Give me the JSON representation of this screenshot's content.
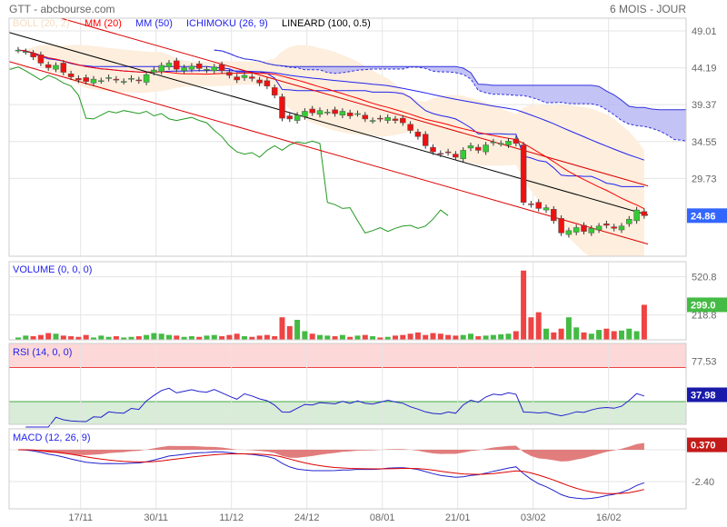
{
  "header": {
    "title": "GTT - abcbourse.com",
    "period": "6 MOIS - JOUR"
  },
  "legend": [
    {
      "label": "BOLL (20, 2)",
      "color": "#f5dcc0"
    },
    {
      "label": "MM (20)",
      "color": "#ff0000"
    },
    {
      "label": "MM (50)",
      "color": "#2222ee"
    },
    {
      "label": "ICHIMOKU (26, 9)",
      "color": "#2222ee"
    },
    {
      "label": "LINEARD (100, 0.5)",
      "color": "#000000"
    }
  ],
  "panels": {
    "volume": "VOLUME (0, 0, 0)",
    "rsi": "RSI (14, 0, 0)",
    "macd": "MACD (12, 26, 9)"
  },
  "chart_data": {
    "type": "candlestick",
    "price_ticks": [
      "49.01",
      "44.19",
      "39.37",
      "34.55",
      "29.73"
    ],
    "price_tick_values": [
      49.01,
      44.19,
      39.37,
      34.55,
      29.73
    ],
    "last_price": {
      "label": "24.86",
      "color": "#3366ff"
    },
    "volume_ticks": [
      "520.8",
      "218.8"
    ],
    "volume_tick_values": [
      520.8,
      218.8
    ],
    "last_volume": {
      "label": "299.0",
      "color": "#44bb44"
    },
    "rsi_ticks": [
      "77.53"
    ],
    "last_rsi": {
      "label": "37.98",
      "color": "#1a1aaa"
    },
    "macd_ticks": [
      "-2.40"
    ],
    "last_macd": {
      "label": "0.370",
      "color": "#c41a1a"
    },
    "x_labels": [
      "17/11",
      "30/11",
      "11/12",
      "24/12",
      "08/01",
      "21/01",
      "03/02",
      "16/02"
    ],
    "x_label_index": [
      9,
      19,
      29,
      39,
      49,
      59,
      69,
      79
    ],
    "closes": [
      46.5,
      46.3,
      45.6,
      44.8,
      44.2,
      44.5,
      43.6,
      43.0,
      42.6,
      42.4,
      42.7,
      42.5,
      42.9,
      42.6,
      42.4,
      42.8,
      42.5,
      43.3,
      43.9,
      44.5,
      44.8,
      44.0,
      44.2,
      44.4,
      44.1,
      44.0,
      44.3,
      43.8,
      43.2,
      42.6,
      43.2,
      42.8,
      42.2,
      41.8,
      40.6,
      37.6,
      37.5,
      38.0,
      38.5,
      38.3,
      38.6,
      38.4,
      38.2,
      38.5,
      37.9,
      38.2,
      37.5,
      37.3,
      37.5,
      37.7,
      37.3,
      37.0,
      36.0,
      35.2,
      34.0,
      33.2,
      32.9,
      33.1,
      32.5,
      33.4,
      34.0,
      33.4,
      34.1,
      34.5,
      34.3,
      34.6,
      34.3,
      26.6,
      26.3,
      25.8,
      25.9,
      24.2,
      22.6,
      22.9,
      23.3,
      22.8,
      23.2,
      23.5,
      23.6,
      23.2,
      23.5,
      24.4,
      25.6,
      24.86
    ],
    "volumes": [
      40,
      55,
      50,
      60,
      75,
      70,
      55,
      50,
      45,
      60,
      40,
      55,
      45,
      50,
      40,
      45,
      50,
      60,
      75,
      70,
      60,
      55,
      45,
      50,
      45,
      55,
      60,
      50,
      60,
      70,
      50,
      45,
      55,
      60,
      50,
      200,
      130,
      180,
      90,
      70,
      60,
      55,
      50,
      60,
      45,
      55,
      60,
      50,
      40,
      45,
      55,
      60,
      70,
      80,
      60,
      75,
      70,
      60,
      55,
      60,
      70,
      50,
      55,
      60,
      65,
      70,
      90,
      570,
      200,
      240,
      110,
      80,
      110,
      200,
      120,
      80,
      70,
      100,
      110,
      90,
      95,
      110,
      90,
      299
    ]
  }
}
